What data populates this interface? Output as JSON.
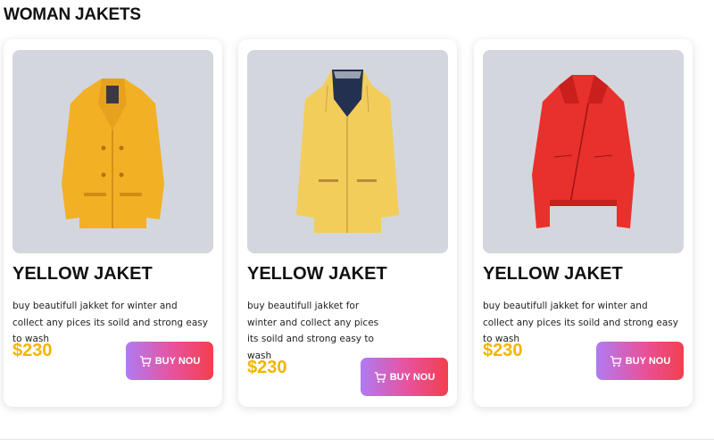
{
  "page": {
    "title": "WOMAN JAKETS"
  },
  "products": [
    {
      "title": "YELLOW JAKET",
      "description": "buy beautifull jakket for winter and collect any pices its soild and strong easy to wash",
      "price": "$230",
      "button_label": "BUY NOU",
      "image": {
        "name": "yellow-peacoat-image",
        "color": "#f2b024"
      }
    },
    {
      "title": "YELLOW JAKET",
      "description": "buy beautifull jakket for winter and collect any pices its soild and strong easy to wash",
      "price": "$230",
      "button_label": "BUY NOU",
      "image": {
        "name": "yellow-raincoat-image",
        "color": "#f3cd5a"
      }
    },
    {
      "title": "YELLOW JAKET",
      "description": "buy beautifull jakket for winter and collect any pices its soild and strong easy to wash",
      "price": "$230",
      "button_label": "BUY NOU",
      "image": {
        "name": "red-leather-jacket-image",
        "color": "#e8302c"
      }
    }
  ],
  "colors": {
    "price": "#f4b400",
    "button_gradient": [
      "#b07bf3",
      "#e9519a",
      "#f23f4e"
    ],
    "image_background": "#d3d6dc"
  },
  "icons": {
    "cart": "cart-icon"
  }
}
